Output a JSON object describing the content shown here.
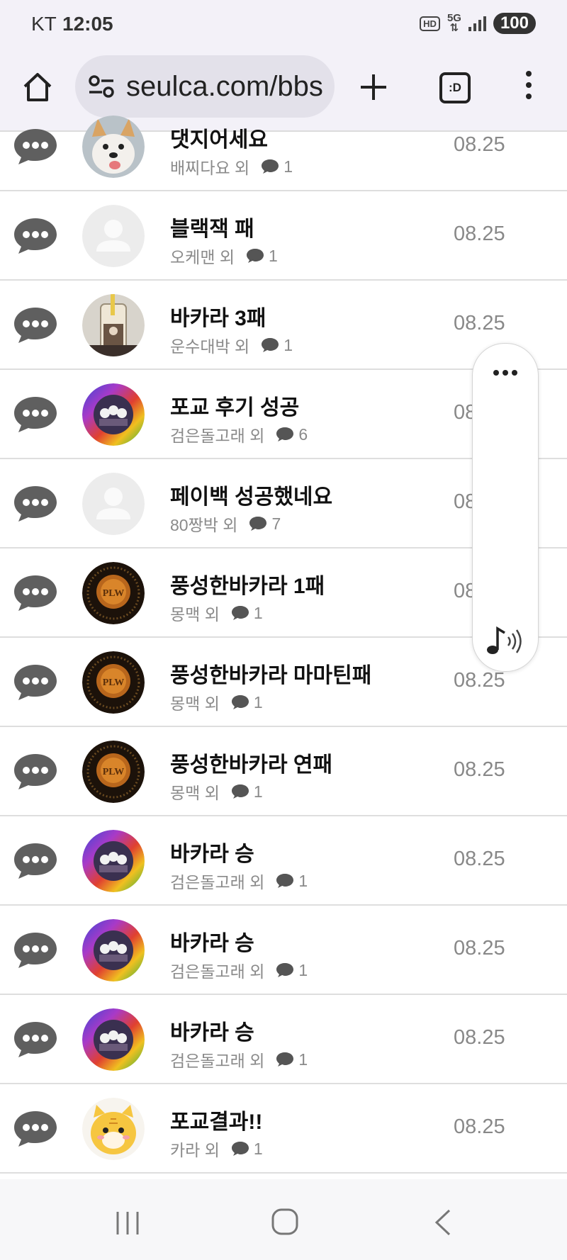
{
  "status_bar": {
    "carrier": "KT",
    "time": "12:05",
    "hd_label": "HD",
    "network_label": "5G",
    "battery": "100"
  },
  "browser": {
    "url": "seulca.com/bbs",
    "tab_icon_label": ":D"
  },
  "posts": [
    {
      "title": "댓지어세요",
      "author": "배찌다요 외",
      "comments": "1",
      "date": "08.25",
      "avatar": "dog"
    },
    {
      "title": "블랙잭 패",
      "author": "오케맨 외",
      "comments": "1",
      "date": "08.25",
      "avatar": "default"
    },
    {
      "title": "바카라 3패",
      "author": "운수대박 외",
      "comments": "1",
      "date": "08.25",
      "avatar": "cup"
    },
    {
      "title": "포교 후기 성공",
      "author": "검은돌고래 외",
      "comments": "6",
      "date": "08.25",
      "avatar": "rainbow"
    },
    {
      "title": "페이백 성공했네요",
      "author": "80짱박 외",
      "comments": "7",
      "date": "08.25",
      "avatar": "default"
    },
    {
      "title": "풍성한바카라 1패",
      "author": "몽맥 외",
      "comments": "1",
      "date": "08.25",
      "avatar": "dark-orange"
    },
    {
      "title": "풍성한바카라 마마틴패",
      "author": "몽맥 외",
      "comments": "1",
      "date": "08.25",
      "avatar": "dark-orange"
    },
    {
      "title": "풍성한바카라 연패",
      "author": "몽맥 외",
      "comments": "1",
      "date": "08.25",
      "avatar": "dark-orange"
    },
    {
      "title": "바카라 승",
      "author": "검은돌고래 외",
      "comments": "1",
      "date": "08.25",
      "avatar": "rainbow"
    },
    {
      "title": "바카라 승",
      "author": "검은돌고래 외",
      "comments": "1",
      "date": "08.25",
      "avatar": "rainbow"
    },
    {
      "title": "바카라 승",
      "author": "검은돌고래 외",
      "comments": "1",
      "date": "08.25",
      "avatar": "rainbow"
    },
    {
      "title": "포교결과!!",
      "author": "카라 외",
      "comments": "1",
      "date": "08.25",
      "avatar": "tiger"
    }
  ],
  "icons": {
    "row_icon": "chat-bubble-icon",
    "comment_icon": "comment-icon",
    "panel_menu": "more-dots-icon",
    "panel_audio": "music-note-icon"
  },
  "colors": {
    "browser_chrome": "#f3f1f8",
    "row_icon": "#5f5f5f",
    "meta_text": "#8a8a8a",
    "date_text": "#888888",
    "divider": "#dedede"
  }
}
